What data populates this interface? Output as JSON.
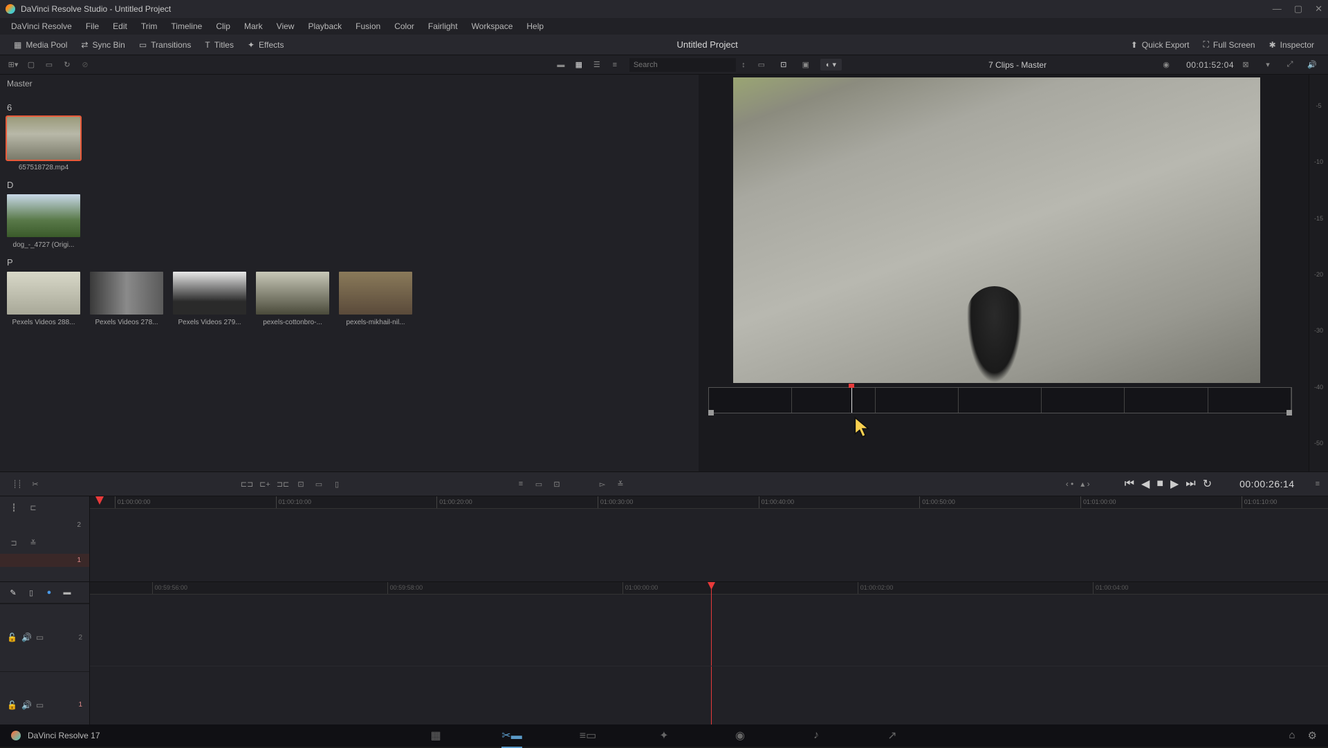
{
  "app": {
    "title": "DaVinci Resolve Studio - Untitled Project",
    "version_label": "DaVinci Resolve 17"
  },
  "menu": [
    "DaVinci Resolve",
    "File",
    "Edit",
    "Trim",
    "Timeline",
    "Clip",
    "Mark",
    "View",
    "Playback",
    "Fusion",
    "Color",
    "Fairlight",
    "Workspace",
    "Help"
  ],
  "toolbar": {
    "media_pool": "Media Pool",
    "sync_bin": "Sync Bin",
    "transitions": "Transitions",
    "titles": "Titles",
    "effects": "Effects",
    "project_title": "Untitled Project",
    "quick_export": "Quick Export",
    "full_screen": "Full Screen",
    "inspector": "Inspector"
  },
  "search": {
    "placeholder": "Search"
  },
  "viewer": {
    "clips_label": "7 Clips - Master",
    "duration": "00:01:52:04",
    "timecode": "00:00:26:14"
  },
  "media": {
    "root_label": "Master",
    "sections": [
      {
        "title": "6",
        "clips": [
          {
            "name": "657518728.mp4",
            "thumb": "road",
            "selected": true
          }
        ]
      },
      {
        "title": "D",
        "clips": [
          {
            "name": "dog_-_4727 (Origi...",
            "thumb": "dog"
          }
        ]
      },
      {
        "title": "P",
        "clips": [
          {
            "name": "Pexels Videos 288...",
            "thumb": "p1"
          },
          {
            "name": "Pexels Videos 278...",
            "thumb": "p2"
          },
          {
            "name": "Pexels Videos 279...",
            "thumb": "p3"
          },
          {
            "name": "pexels-cottonbro-...",
            "thumb": "p4"
          },
          {
            "name": "pexels-mikhail-nil...",
            "thumb": "p5"
          }
        ]
      }
    ]
  },
  "audio_meter_ticks": [
    "-5",
    "-10",
    "-15",
    "-20",
    "-30",
    "-40",
    "-50"
  ],
  "timeline_upper_ticks": [
    "01:00:00:00",
    "01:00:10:00",
    "01:00:20:00",
    "01:00:30:00",
    "01:00:40:00",
    "01:00:50:00",
    "01:01:00:00",
    "01:01:10:00"
  ],
  "timeline_audio_ticks": [
    "00:59:56:00",
    "00:59:58:00",
    "01:00:00:00",
    "01:00:02:00",
    "01:00:04:00"
  ],
  "tracks": {
    "v2": "2",
    "v1": "1",
    "a1": "2",
    "a2": "1"
  }
}
